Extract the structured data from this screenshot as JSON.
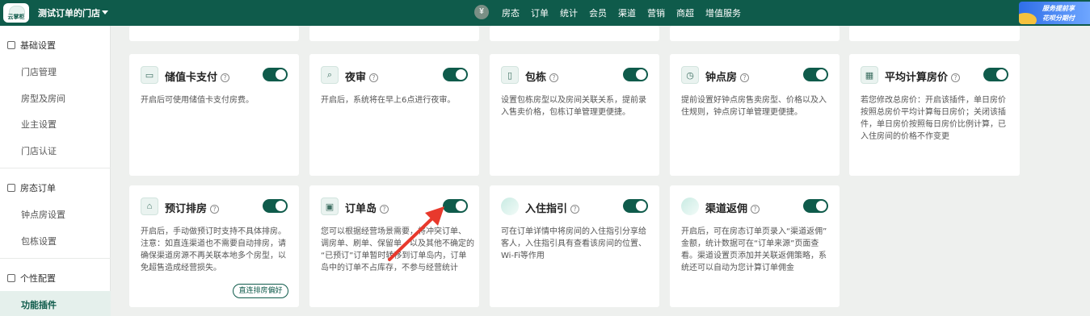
{
  "topbar": {
    "logo_text": "云掌柜",
    "store_name": "测试订单的门店",
    "nav": [
      "房态",
      "订单",
      "统计",
      "会员",
      "渠道",
      "营销",
      "商超",
      "增值服务"
    ],
    "promo_line1": "服务提前享",
    "promo_line2": "花呗分期付"
  },
  "sidebar": {
    "group1": "基础设置",
    "group1_items": [
      "门店管理",
      "房型及房间",
      "业主设置",
      "门店认证"
    ],
    "group2": "房态订单",
    "group2_items": [
      "钟点房设置",
      "包栋设置"
    ],
    "group3": "个性配置",
    "active_item": "功能插件"
  },
  "cards_row1": [
    {
      "title": "储值卡支付",
      "icon": "card-icon",
      "enabled": true,
      "desc": [
        "开启后可使用储值卡支付房费。"
      ]
    },
    {
      "title": "夜审",
      "icon": "search-doc-icon",
      "enabled": true,
      "desc": [
        "开启后，系统将在早上6点进行夜审。"
      ]
    },
    {
      "title": "包栋",
      "icon": "map-icon",
      "enabled": true,
      "desc": [
        "设置包栋房型以及房间关联关系，提前录",
        "入售卖价格，包栋订单管理更便捷。"
      ]
    },
    {
      "title": "钟点房",
      "icon": "clock-icon",
      "enabled": true,
      "desc": [
        "提前设置好钟点房售卖房型、价格以及入",
        "住规则，钟点房订单管理更便捷。"
      ]
    },
    {
      "title": "平均计算房价",
      "icon": "calculator-icon",
      "enabled": true,
      "desc": [
        "若您修改总房价：开启该插件，单日房价",
        "按照总房价平均计算每日房价；关闭该插",
        "件，单日房价按照每日房价比例计算，已",
        "入住房间的价格不作变更"
      ]
    }
  ],
  "cards_row2": [
    {
      "title": "预订排房",
      "icon": "house-check-icon",
      "enabled": true,
      "desc": [
        "开启后，手动做预订时支持不具体排房。",
        "注意：如直连渠道也不需要自动排房，请",
        "确保渠道房源不再关联本地多个房型，以",
        "免超售造成经营损失。"
      ],
      "button": "直连排房偏好"
    },
    {
      "title": "订单岛",
      "icon": "box-icon",
      "enabled": true,
      "desc": [
        "您可以根据经营场景需要，将冲突订单、",
        "调房单、刷单、保留单，以及其他不确定的",
        "“已预订”订单暂时转移到订单岛内，订单",
        "岛中的订单不占库存，不参与经营统计"
      ]
    },
    {
      "title": "入住指引",
      "icon": "guide-icon",
      "enabled": true,
      "desc": [
        "可在订单详情中将房间的入住指引分享给",
        "客人，入住指引具有查看该房间的位置、",
        "Wi-Fi等作用"
      ]
    },
    {
      "title": "渠道返佣",
      "icon": "commission-icon",
      "enabled": true,
      "desc": [
        "开启后，可在房态订单页录入“渠道返佣”",
        "金额，统计数据可在“订单来源”页面查",
        "看。渠道设置页添加并关联返佣策略，系",
        "统还可以自动为您计算订单佣金"
      ]
    }
  ]
}
